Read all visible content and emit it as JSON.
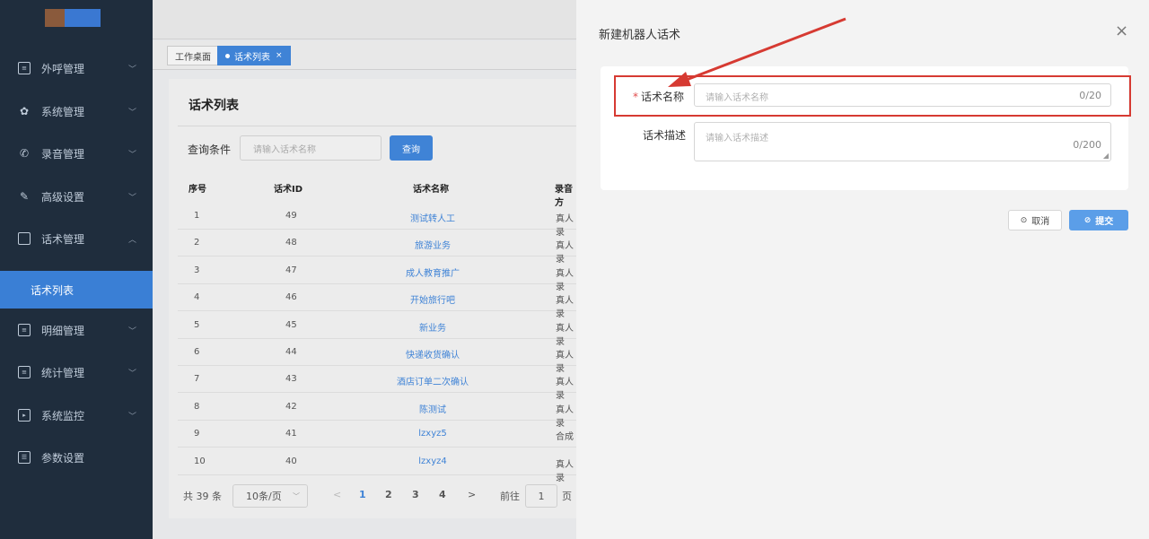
{
  "sidebar": {
    "items": [
      {
        "label": "外呼管理",
        "icon": "document-icon",
        "chevron": "﹀"
      },
      {
        "label": "系统管理",
        "icon": "gear-icon",
        "chevron": "﹀"
      },
      {
        "label": "录音管理",
        "icon": "phone-icon",
        "chevron": "﹀"
      },
      {
        "label": "高级设置",
        "icon": "pen-icon",
        "chevron": "﹀"
      },
      {
        "label": "话术管理",
        "icon": "chat-icon",
        "chevron": "︿"
      },
      {
        "label": "明细管理",
        "icon": "document-icon",
        "chevron": "﹀"
      },
      {
        "label": "统计管理",
        "icon": "document-icon",
        "chevron": "﹀"
      },
      {
        "label": "系统监控",
        "icon": "camera-icon",
        "chevron": "﹀"
      },
      {
        "label": "参数设置",
        "icon": "settings-box-icon",
        "chevron": ""
      }
    ],
    "active_sub": "话术列表"
  },
  "tabs": [
    {
      "label": "工作桌面",
      "active": false
    },
    {
      "label": "话术列表",
      "active": true
    }
  ],
  "list": {
    "title": "话术列表",
    "query_label": "查询条件",
    "query_placeholder": "请输入话术名称",
    "query_button": "查询",
    "columns": [
      "序号",
      "话术ID",
      "话术名称",
      "录音方"
    ],
    "rows": [
      {
        "no": "1",
        "id": "49",
        "name": "测试转人工",
        "rec": "真人录"
      },
      {
        "no": "2",
        "id": "48",
        "name": "旅游业务",
        "rec": "真人录"
      },
      {
        "no": "3",
        "id": "47",
        "name": "成人教育推广",
        "rec": "真人录"
      },
      {
        "no": "4",
        "id": "46",
        "name": "开始旅行吧",
        "rec": "真人录"
      },
      {
        "no": "5",
        "id": "45",
        "name": "新业务",
        "rec": "真人录"
      },
      {
        "no": "6",
        "id": "44",
        "name": "快递收货确认",
        "rec": "真人录"
      },
      {
        "no": "7",
        "id": "43",
        "name": "酒店订单二次确认",
        "rec": "真人录"
      },
      {
        "no": "8",
        "id": "42",
        "name": "陈测试",
        "rec": "真人录"
      },
      {
        "no": "9",
        "id": "41",
        "name": "lzxyz5",
        "rec": "合成"
      },
      {
        "no": "10",
        "id": "40",
        "name": "lzxyz4",
        "rec": "真人录"
      }
    ],
    "pager": {
      "total": "共 39 条",
      "page_size": "10条/页",
      "prev": "<",
      "pages": [
        "1",
        "2",
        "3",
        "4"
      ],
      "next": ">",
      "goto_label": "前往",
      "goto_value": "1",
      "page_suffix": "页"
    }
  },
  "drawer": {
    "title": "新建机器人话术",
    "close": "×",
    "name_label": "话术名称",
    "name_placeholder": "请输入话术名称",
    "name_count": "0/20",
    "desc_label": "话术描述",
    "desc_placeholder": "请输入话术描述",
    "desc_count": "0/200",
    "cancel_label": "取消",
    "submit_label": "提交"
  },
  "colors": {
    "sidebar_bg": "#1f2d3d",
    "accent": "#3f83d6",
    "annotation_red": "#d63a32"
  }
}
